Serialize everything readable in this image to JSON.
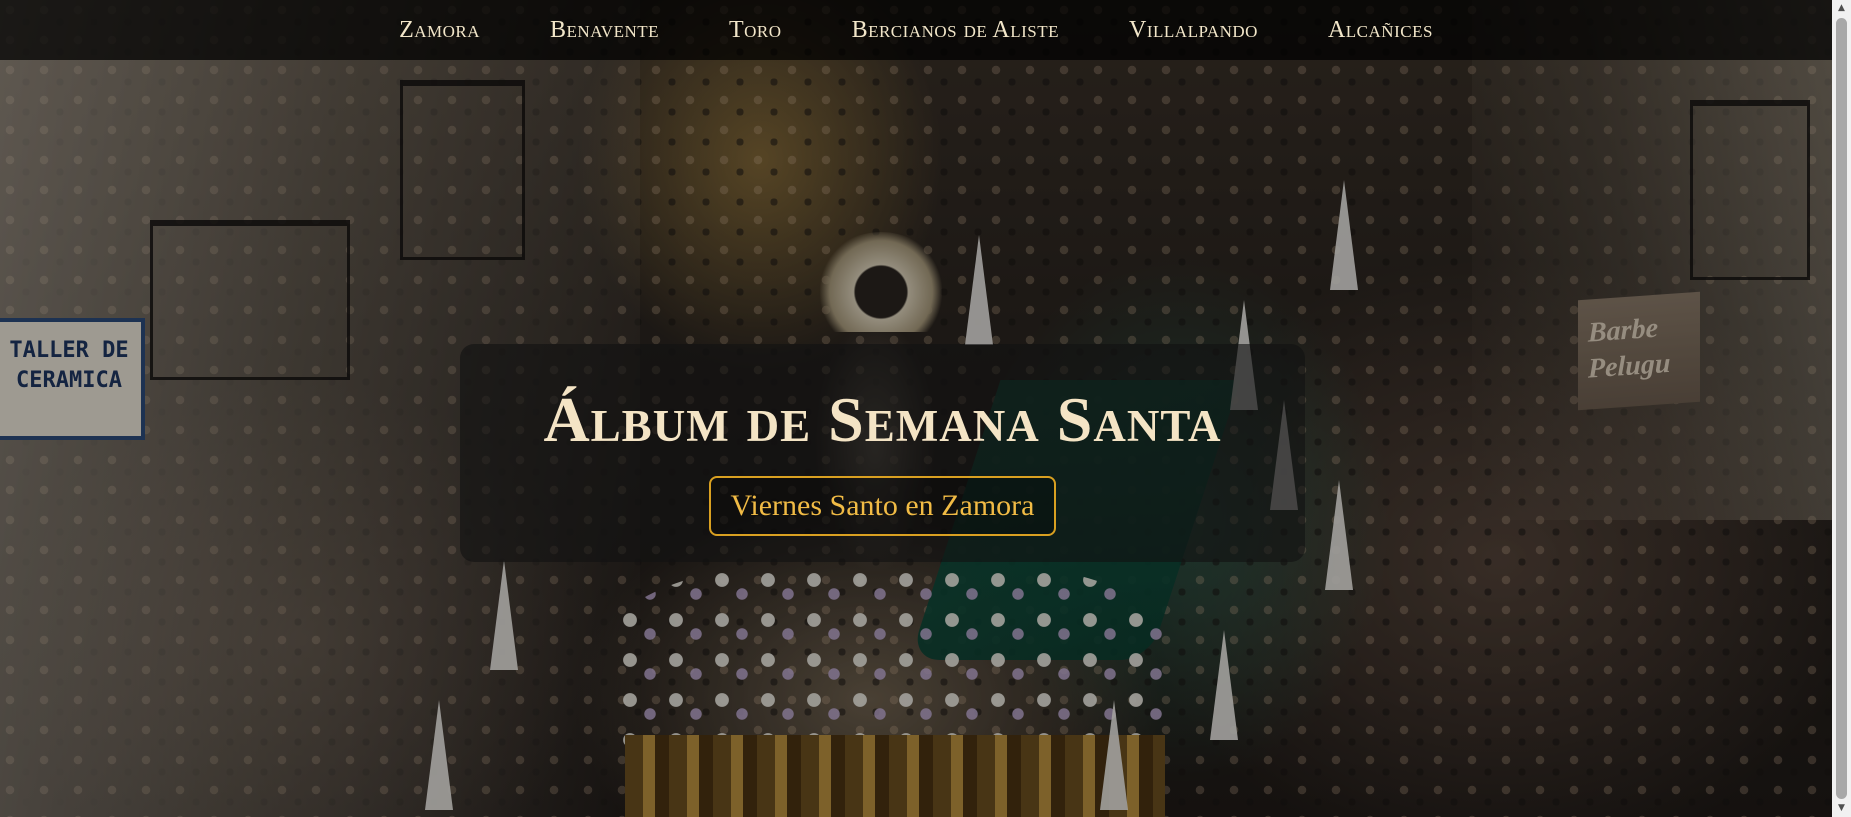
{
  "nav": {
    "items": [
      "Zamora",
      "Benavente",
      "Toro",
      "Bercianos de Aliste",
      "Villalpando",
      "Alcañices"
    ]
  },
  "hero": {
    "title": "Álbum de Semana Santa",
    "subtitle": "Viernes Santo en Zamora",
    "photo_signs": {
      "taller": "TALLER DE CERAMICA",
      "barber": "Barbe Pelugu"
    }
  },
  "colors": {
    "title": "#f4e4c5",
    "subtitle_accent": "#d9a021",
    "nav_text": "#f2e6c9"
  }
}
